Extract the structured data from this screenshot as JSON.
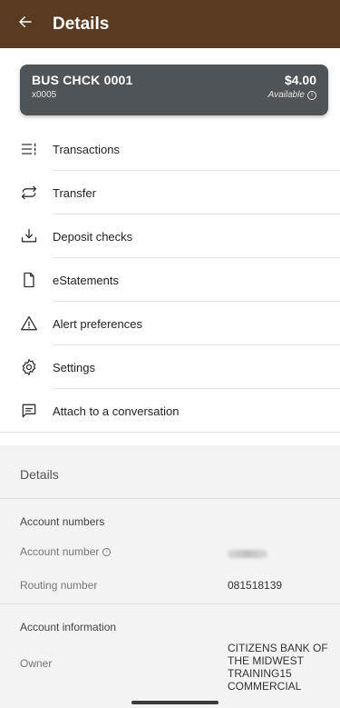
{
  "header": {
    "title": "Details",
    "back_icon": "arrow-left-icon"
  },
  "account": {
    "name": "BUS CHCK 0001",
    "masked_number": "x0005",
    "amount": "$4.00",
    "available_label": "Available",
    "info_symbol": "i"
  },
  "menu": [
    {
      "icon": "list-icon",
      "label": "Transactions"
    },
    {
      "icon": "transfer-icon",
      "label": "Transfer"
    },
    {
      "icon": "deposit-icon",
      "label": "Deposit checks"
    },
    {
      "icon": "document-icon",
      "label": "eStatements"
    },
    {
      "icon": "alert-triangle-icon",
      "label": "Alert preferences"
    },
    {
      "icon": "gear-icon",
      "label": "Settings"
    },
    {
      "icon": "chat-icon",
      "label": "Attach to a conversation"
    }
  ],
  "details": {
    "title": "Details",
    "account_numbers_heading": "Account numbers",
    "account_number_label": "Account number",
    "routing_number_label": "Routing number",
    "routing_number_value": "081518139",
    "account_information_heading": "Account information",
    "owner_label": "Owner",
    "owner_value": "CITIZENS BANK OF THE MIDWEST TRAINING15 COMMERCIAL"
  },
  "colors": {
    "header_bg": "#5a3a21",
    "card_bg": "#4e5458",
    "section_bg": "#f3f3f3"
  }
}
